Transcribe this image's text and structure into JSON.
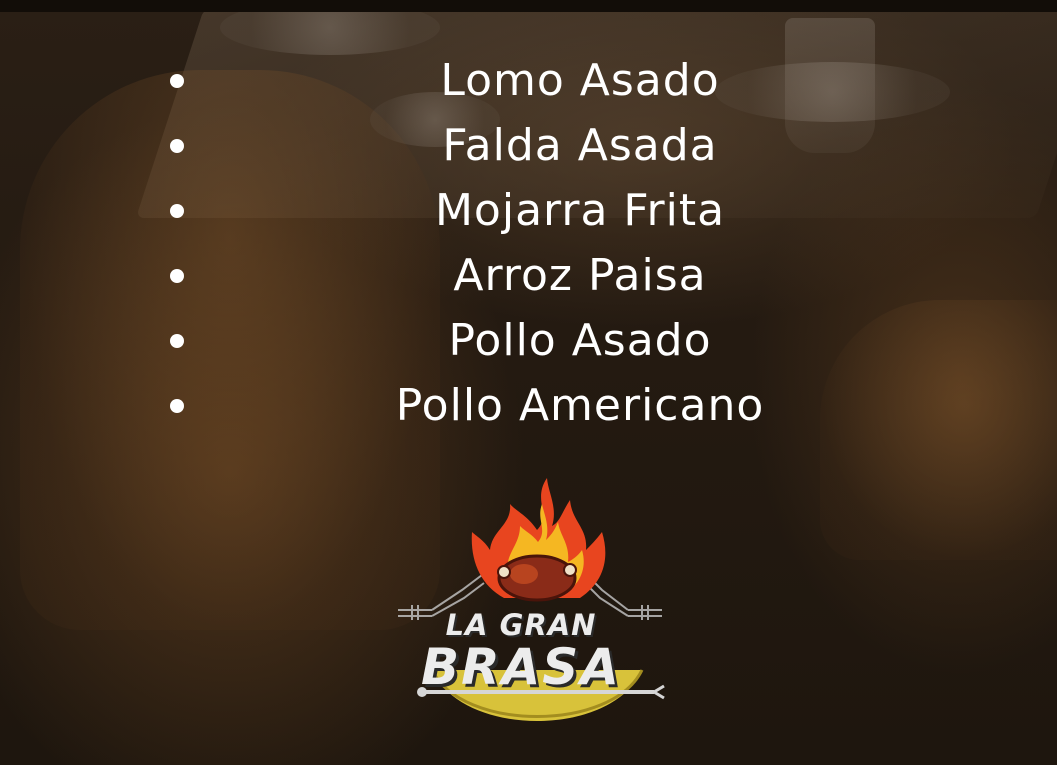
{
  "menu": {
    "items": [
      {
        "label": "Lomo Asado"
      },
      {
        "label": "Falda Asada"
      },
      {
        "label": "Mojarra Frita"
      },
      {
        "label": "Arroz Paisa"
      },
      {
        "label": "Pollo Asado"
      },
      {
        "label": "Pollo Americano"
      }
    ]
  },
  "logo": {
    "line1": "LA GRAN",
    "line2": "BRASA",
    "icon": "flaming-chicken-icon"
  },
  "colors": {
    "text": "#ffffff",
    "flame_outer": "#e8451f",
    "flame_inner": "#f5b722",
    "logo_text": "#ececec",
    "plate": "#d8c23a"
  }
}
